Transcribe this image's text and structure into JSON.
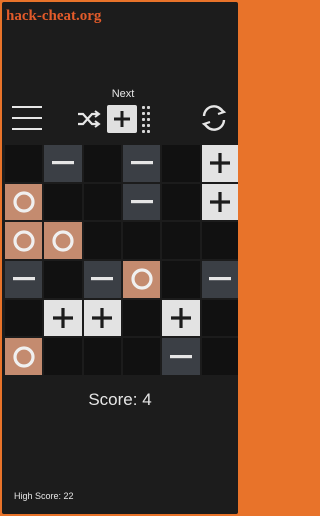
{
  "watermark": "hack-cheat.org",
  "header": {
    "next_label": "Next",
    "next_piece": "plus",
    "menu_icon": "hamburger-icon",
    "shuffle_icon": "shuffle-icon",
    "reset_icon": "refresh-icon"
  },
  "board": {
    "rows": [
      [
        "empty",
        "minus",
        "empty",
        "minus",
        "empty",
        "plus"
      ],
      [
        "circle",
        "empty",
        "empty",
        "minus",
        "empty",
        "plus"
      ],
      [
        "circle",
        "circle",
        "empty",
        "empty",
        "empty",
        "empty"
      ],
      [
        "minus",
        "empty",
        "minus",
        "circle",
        "empty",
        "minus"
      ],
      [
        "empty",
        "plus",
        "plus",
        "empty",
        "plus",
        "empty"
      ],
      [
        "circle",
        "empty",
        "empty",
        "empty",
        "minus",
        "empty"
      ]
    ]
  },
  "score_text": "Score: 4",
  "high_score_text": "High Score: 22",
  "colors": {
    "accent": "#e8732a",
    "minus_tile": "#3b3f45",
    "plus_tile": "#e3e3e3",
    "circle_tile": "#c48b6f",
    "empty_cell": "#111111"
  }
}
